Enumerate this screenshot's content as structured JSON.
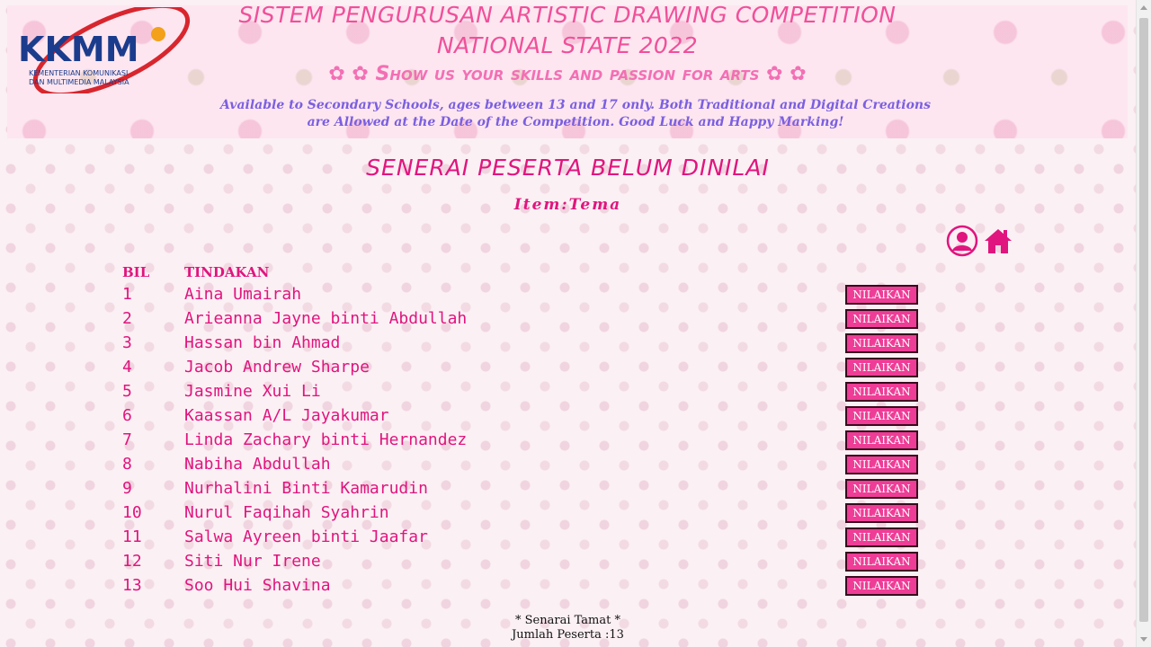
{
  "header": {
    "logo_text": "KKMM",
    "logo_subtext_1": "KEMENTERIAN KOMUNIKASI",
    "logo_subtext_2": "DAN MULTIMEDIA MALAYSIA",
    "title_line_1": "SISTEM PENGURUSAN ARTISTIC DRAWING COMPETITION",
    "title_line_2": "NATIONAL STATE 2022",
    "slogan": "Show us your skills and passion for arts",
    "info": "Available to Secondary Schools, ages between 13 and 17 only. Both Traditional and Digital Creations are Allowed at the Date of the Competition. Good Luck and Happy Marking!"
  },
  "page": {
    "heading": "SENERAI PESERTA BELUM DINILAI",
    "item_label": "Item:",
    "item_value": "Tema"
  },
  "table": {
    "columns": [
      "BIL",
      "TINDAKAN"
    ],
    "button_label": "NILAIKAN",
    "rows": [
      {
        "bil": "1",
        "nama": "Aina Umairah"
      },
      {
        "bil": "2",
        "nama": "Arieanna Jayne binti Abdullah"
      },
      {
        "bil": "3",
        "nama": "Hassan bin Ahmad"
      },
      {
        "bil": "4",
        "nama": "Jacob Andrew Sharpe"
      },
      {
        "bil": "5",
        "nama": "Jasmine Xui Li"
      },
      {
        "bil": "6",
        "nama": "Kaassan A/L Jayakumar"
      },
      {
        "bil": "7",
        "nama": "Linda Zachary binti Hernandez"
      },
      {
        "bil": "8",
        "nama": "Nabiha Abdullah"
      },
      {
        "bil": "9",
        "nama": "Nurhalini Binti Kamarudin"
      },
      {
        "bil": "10",
        "nama": "Nurul Faqihah Syahrin"
      },
      {
        "bil": "11",
        "nama": "Salwa Ayreen binti Jaafar"
      },
      {
        "bil": "12",
        "nama": "Siti Nur Irene"
      },
      {
        "bil": "13",
        "nama": "Soo Hui Shavina"
      }
    ]
  },
  "footer": {
    "end_text": "* Senarai Tamat *",
    "total_text": "Jumlah Peserta :13"
  },
  "icons": {
    "profile": "user-profile-icon",
    "home": "home-icon"
  },
  "colors": {
    "accent": "#e0157e",
    "button": "#ee3d96",
    "info_text": "#7b5fe0"
  }
}
